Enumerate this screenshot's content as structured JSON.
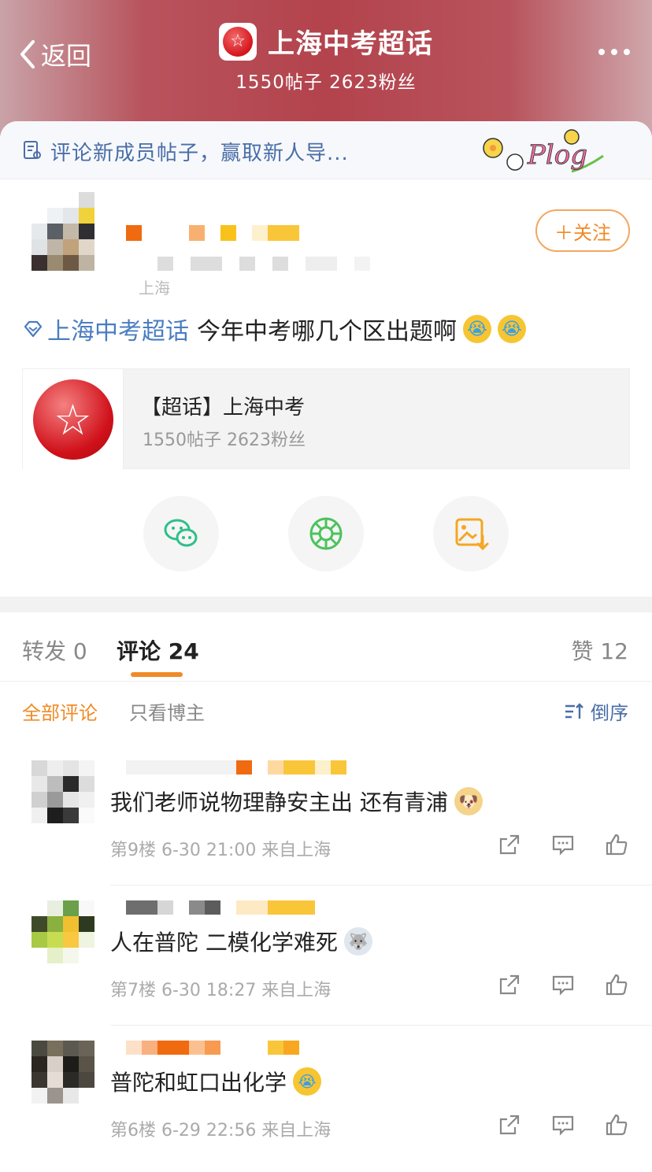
{
  "header": {
    "back_label": "返回",
    "title": "上海中考超话",
    "subtitle": "1550帖子 2623粉丝"
  },
  "banner": {
    "text": "评论新成员帖子，赢取新人导...",
    "sticker_text": "Plog"
  },
  "post": {
    "location": "上海",
    "follow_label": "＋关注",
    "topic": "上海中考超话",
    "text": "今年中考哪几个区出题啊",
    "emoji": [
      "cry-emoji",
      "cry-emoji"
    ]
  },
  "topic_card": {
    "title": "【超话】上海中考",
    "stats": "1550帖子 2623粉丝"
  },
  "share": [
    "wechat-icon",
    "moments-icon",
    "save-image-icon"
  ],
  "tabs": {
    "repost": "转发 0",
    "comments": "评论 24",
    "likes": "赞 12"
  },
  "filters": {
    "all": "全部评论",
    "host_only": "只看博主",
    "sort": "倒序"
  },
  "comments": [
    {
      "text": "我们老师说物理静安主出 还有青浦",
      "emoji": "doge-emoji",
      "meta": "第9楼 6-30 21:00 来自上海"
    },
    {
      "text": "人在普陀 二模化学难死",
      "emoji": "husky-emoji",
      "meta": "第7楼 6-30 18:27 来自上海"
    },
    {
      "text": "普陀和虹口出化学",
      "emoji": "cry-emoji",
      "meta": "第6楼 6-29 22:56 来自上海"
    }
  ],
  "colors": {
    "accent": "#f08a26",
    "link": "#4a7ec0",
    "header": "#b3434d"
  }
}
